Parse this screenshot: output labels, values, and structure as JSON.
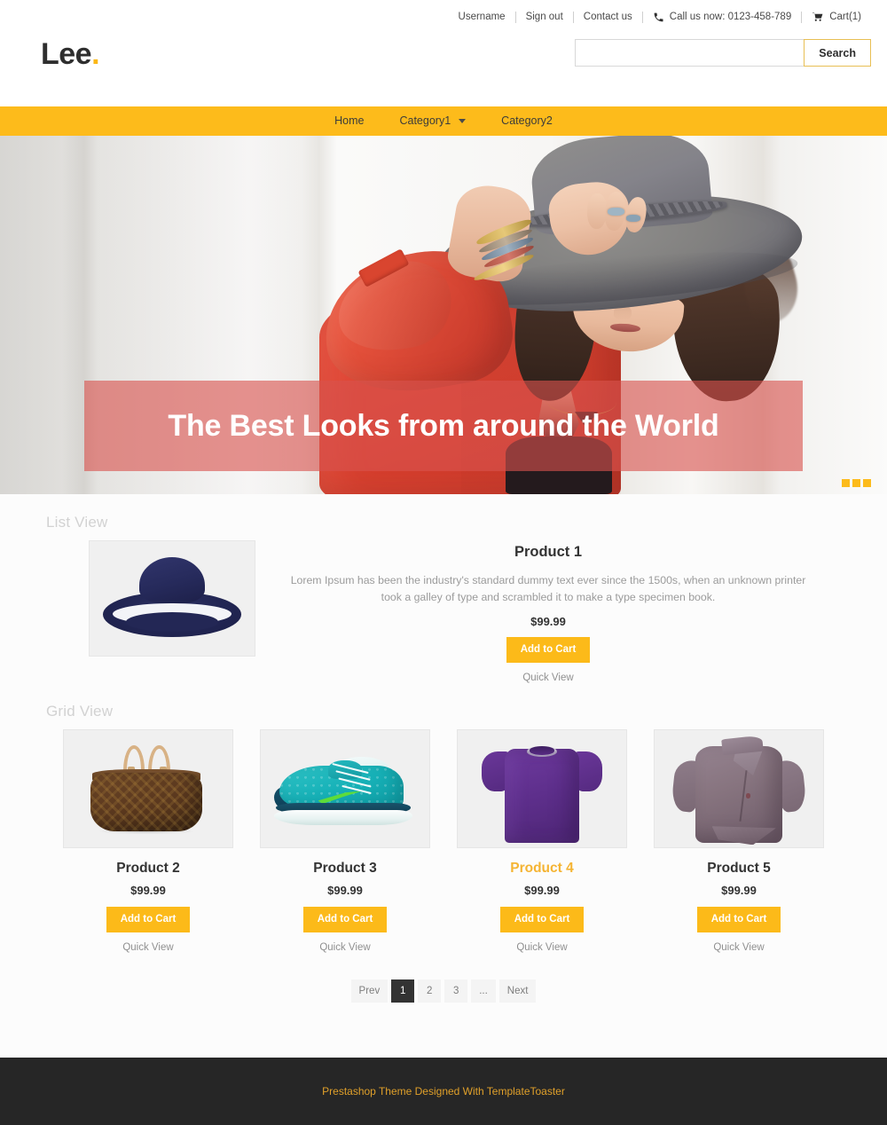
{
  "topbar": {
    "username": "Username",
    "sign_out": "Sign out",
    "contact": "Contact us",
    "phone_icon": "phone-icon",
    "phone": "Call us now: 0123-458-789",
    "cart_icon": "cart-icon",
    "cart": "Cart(1)"
  },
  "header": {
    "logo": "Lee",
    "logo_dot": ".",
    "search_value": "",
    "search_placeholder": "",
    "search_button": "Search"
  },
  "nav": {
    "items": [
      {
        "label": "Home",
        "has_caret": false
      },
      {
        "label": "Category1",
        "has_caret": true
      },
      {
        "label": "Category2",
        "has_caret": false
      }
    ]
  },
  "hero": {
    "title": "The Best Looks from around the World",
    "image_alt": "woman-in-red-blouse-with-grey-floppy-hat",
    "slides": 3,
    "active_slide": 1,
    "overlay_color": "#d9524e",
    "dot_color": "#fcbb1c"
  },
  "sections": {
    "list_view_title": "List View",
    "grid_view_title": "Grid View"
  },
  "labels": {
    "add_to_cart": "Add to Cart",
    "quick_view": "Quick View"
  },
  "list_product": {
    "name": "Product 1",
    "image_alt": "navy-blue-sun-hat",
    "description": "Lorem Ipsum has been the industry's standard dummy text ever since the 1500s, when an unknown printer took a galley of type and scrambled it to make a type specimen book.",
    "price": "$99.99",
    "add_to_cart": "Add to Cart",
    "quick_view": "Quick View"
  },
  "grid_products": [
    {
      "name": "Product 2",
      "image_alt": "brown-monogram-handbag",
      "price": "$99.99",
      "add_to_cart": "Add to Cart",
      "quick_view": "Quick View",
      "highlighted": false
    },
    {
      "name": "Product 3",
      "image_alt": "teal-running-sneaker",
      "price": "$99.99",
      "add_to_cart": "Add to Cart",
      "quick_view": "Quick View",
      "highlighted": false
    },
    {
      "name": "Product 4",
      "image_alt": "purple-t-shirt",
      "price": "$99.99",
      "add_to_cart": "Add to Cart",
      "quick_view": "Quick View",
      "highlighted": true
    },
    {
      "name": "Product 5",
      "image_alt": "mauve-asymmetric-jacket",
      "price": "$99.99",
      "add_to_cart": "Add to Cart",
      "quick_view": "Quick View",
      "highlighted": false
    }
  ],
  "pagination": {
    "prev": "Prev",
    "pages": [
      "1",
      "2",
      "3",
      "..."
    ],
    "active_page": "1",
    "next": "Next"
  },
  "footer": {
    "text": "Prestashop Theme Designed With TemplateToaster"
  },
  "colors": {
    "accent": "#fcba19",
    "nav_bg": "#fdbb1b",
    "footer_bg": "#262626",
    "footer_text": "#e0a02a",
    "hero_overlay": "#d9524e"
  }
}
